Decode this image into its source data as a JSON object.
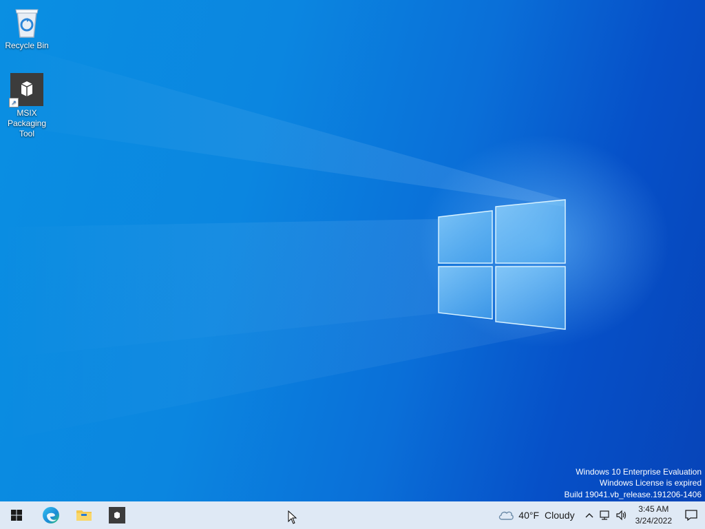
{
  "desktop": {
    "icons": [
      {
        "label": "Recycle Bin",
        "icon": "recycle-bin-icon"
      },
      {
        "label": "MSIX Packaging Tool",
        "icon": "msix-packaging-tool-icon"
      }
    ],
    "watermark": {
      "line1": "Windows 10 Enterprise Evaluation",
      "line2": "Windows License is expired",
      "line3": "Build 19041.vb_release.191206-1406"
    }
  },
  "taskbar": {
    "start": {
      "icon": "windows-logo-icon"
    },
    "pinned": [
      {
        "name": "Microsoft Edge",
        "icon": "edge-icon"
      },
      {
        "name": "File Explorer",
        "icon": "folder-icon"
      },
      {
        "name": "MSIX Packaging Tool",
        "icon": "msix-icon"
      }
    ],
    "tray": {
      "weather_temp": "40°F",
      "weather_text": "Cloudy",
      "weather_icon": "cloud-icon",
      "time": "3:45 AM",
      "date": "3/24/2022"
    }
  },
  "colors": {
    "taskbar": "#dfe9f5",
    "wallpaper_light": "#0a8fe2",
    "wallpaper_dark": "#0744b8"
  }
}
